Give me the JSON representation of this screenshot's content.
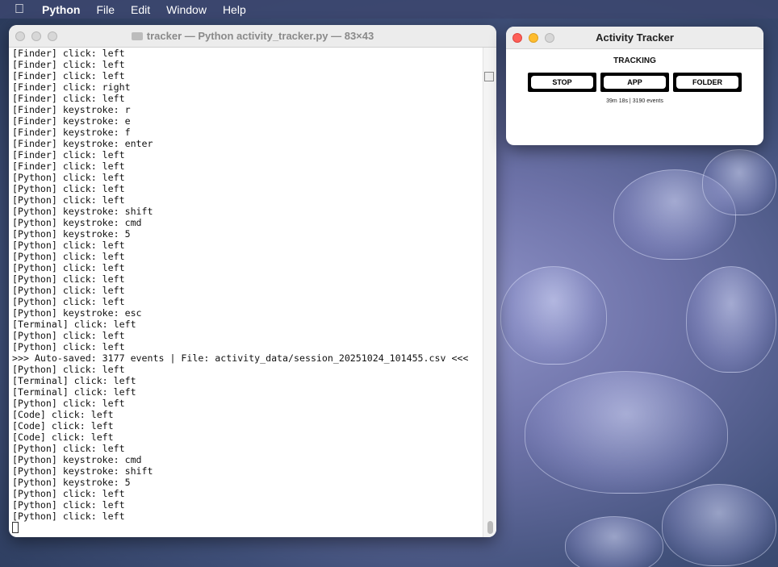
{
  "menubar": {
    "apple_icon": "apple-icon",
    "app_name": "Python",
    "items": [
      "File",
      "Edit",
      "Window",
      "Help"
    ]
  },
  "terminal": {
    "title": "tracker — Python activity_tracker.py — 83×43",
    "lines": [
      "[Finder] click: left",
      "[Finder] click: left",
      "[Finder] click: left",
      "[Finder] click: right",
      "[Finder] click: left",
      "[Finder] keystroke: r",
      "[Finder] keystroke: e",
      "[Finder] keystroke: f",
      "[Finder] keystroke: enter",
      "[Finder] click: left",
      "[Finder] click: left",
      "[Python] click: left",
      "[Python] click: left",
      "[Python] click: left",
      "[Python] keystroke: shift",
      "[Python] keystroke: cmd",
      "[Python] keystroke: 5",
      "[Python] click: left",
      "[Python] click: left",
      "[Python] click: left",
      "[Python] click: left",
      "[Python] click: left",
      "[Python] click: left",
      "[Python] keystroke: esc",
      "[Terminal] click: left",
      "[Python] click: left",
      "[Python] click: left",
      ">>> Auto-saved: 3177 events | File: activity_data/session_20251024_101455.csv <<<",
      "[Python] click: left",
      "[Terminal] click: left",
      "[Terminal] click: left",
      "[Python] click: left",
      "[Code] click: left",
      "[Code] click: left",
      "[Code] click: left",
      "[Python] click: left",
      "[Python] keystroke: cmd",
      "[Python] keystroke: shift",
      "[Python] keystroke: 5",
      "[Python] click: left",
      "[Python] click: left",
      "[Python] click: left"
    ]
  },
  "tracker": {
    "title": "Activity Tracker",
    "status": "TRACKING",
    "buttons": {
      "stop": "STOP",
      "app": "APP",
      "folder": "FOLDER"
    },
    "stats": "39m 18s | 3190 events"
  }
}
